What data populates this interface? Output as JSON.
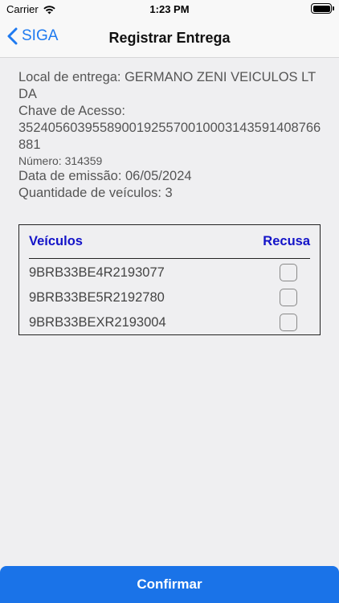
{
  "status": {
    "carrier": "Carrier",
    "time": "1:23 PM"
  },
  "nav": {
    "back_label": "SIGA",
    "title": "Registrar Entrega"
  },
  "info": {
    "local_line": "Local de entrega: GERMANO ZENI VEICULOS LTDA",
    "chave_label": "Chave de Acesso:",
    "chave_value": "35240560395589001925570010003143591408766881",
    "numero": "Número: 314359",
    "data_emissao": "Data de emissão: 06/05/2024",
    "quantidade": "Quantidade de veículos: 3"
  },
  "table": {
    "header_vehicles": "Veículos",
    "header_refusal": "Recusa",
    "rows": [
      {
        "vin": "9BRB33BE4R2193077",
        "refused": false
      },
      {
        "vin": "9BRB33BE5R2192780",
        "refused": false
      },
      {
        "vin": "9BRB33BEXR2193004",
        "refused": false
      }
    ]
  },
  "confirm_label": "Confirmar",
  "colors": {
    "accent": "#1a73e8",
    "header_text": "#1313c8",
    "back_link": "#1e7af0"
  }
}
